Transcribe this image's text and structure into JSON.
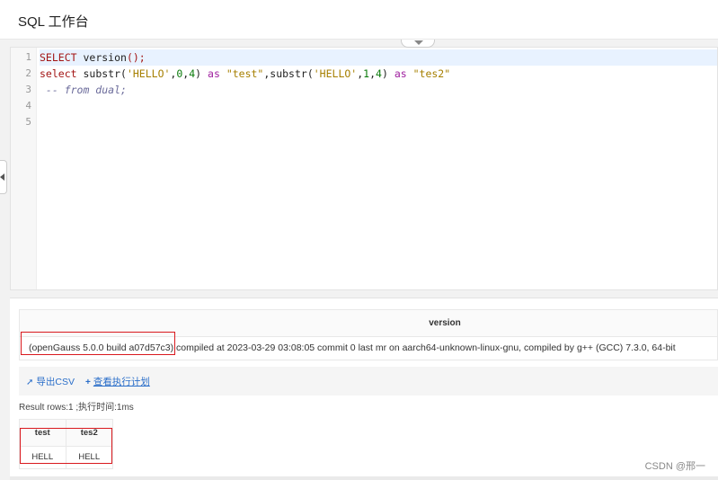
{
  "header": {
    "title": "SQL 工作台"
  },
  "editor": {
    "line_numbers": [
      "1",
      "2",
      "3",
      "4",
      "5"
    ],
    "lines": [
      {
        "parts": [
          {
            "t": "SELECT",
            "c": "kw"
          },
          {
            "t": " version",
            "c": "fn"
          },
          {
            "t": "();",
            "c": "kw"
          }
        ]
      },
      {
        "parts": [
          {
            "t": "select",
            "c": "kw"
          },
          {
            "t": " substr",
            "c": "fn"
          },
          {
            "t": "(",
            "c": "kw2"
          },
          {
            "t": "'HELLO'",
            "c": "str"
          },
          {
            "t": ",",
            "c": "kw2"
          },
          {
            "t": "0",
            "c": "num"
          },
          {
            "t": ",",
            "c": "kw2"
          },
          {
            "t": "4",
            "c": "num"
          },
          {
            "t": ")",
            "c": "kw2"
          },
          {
            "t": " as ",
            "c": "as"
          },
          {
            "t": "\"test\"",
            "c": "str"
          },
          {
            "t": ",substr(",
            "c": "fn"
          },
          {
            "t": "'HELLO'",
            "c": "str"
          },
          {
            "t": ",",
            "c": "kw2"
          },
          {
            "t": "1",
            "c": "num"
          },
          {
            "t": ",",
            "c": "kw2"
          },
          {
            "t": "4",
            "c": "num"
          },
          {
            "t": ")",
            "c": "kw2"
          },
          {
            "t": " as ",
            "c": "as"
          },
          {
            "t": "\"tes2\"",
            "c": "str"
          }
        ]
      },
      {
        "parts": [
          {
            "t": " -- from dual;",
            "c": "comment"
          }
        ]
      },
      {
        "parts": []
      },
      {
        "parts": []
      }
    ]
  },
  "result_version": {
    "column": "version",
    "value": "(openGauss 5.0.0 build a07d57c3) compiled at 2023-03-29 03:08:05 commit 0 last mr on aarch64-unknown-linux-gnu, compiled by g++ (GCC) 7.3.0, 64-bit"
  },
  "actions": {
    "export_csv": "导出CSV",
    "view_plan": "查看执行计划"
  },
  "result_info": "Result rows:1 ;执行时间:1ms",
  "result_table": {
    "columns": [
      "test",
      "tes2"
    ],
    "rows": [
      [
        "HELL",
        "HELL"
      ]
    ]
  },
  "watermark": "CSDN @邢一",
  "icons": {
    "export": "export-arrow-icon",
    "plan": "plus-icon",
    "collapse": "chevron-down-icon",
    "side": "chevron-left-icon"
  },
  "colors": {
    "accent": "#2a6ec9",
    "highlight_box": "#d9191e"
  }
}
